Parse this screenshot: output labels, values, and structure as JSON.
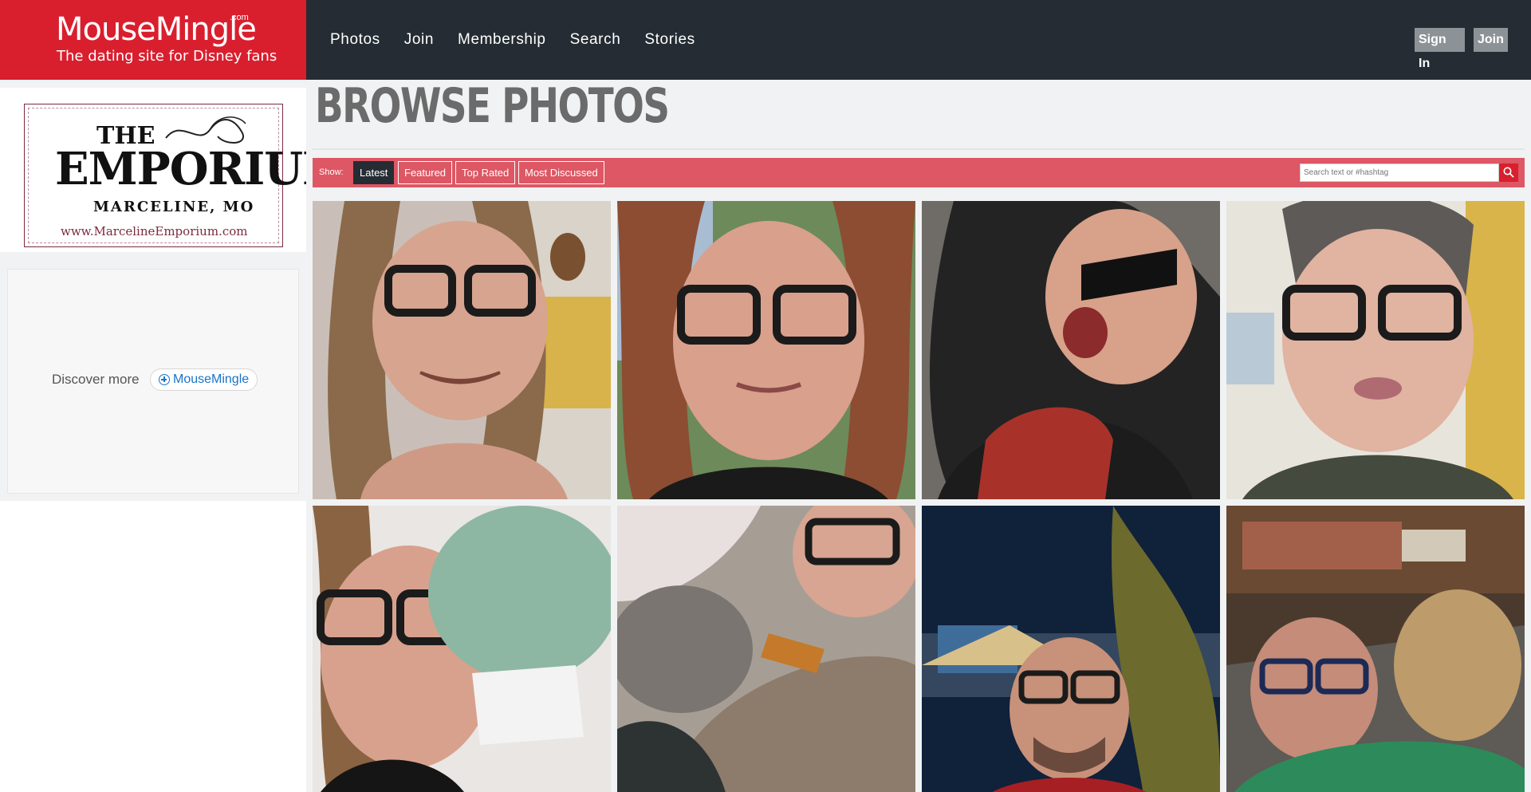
{
  "brand": {
    "name": "MouseMingle",
    "com": ".com",
    "tagline": "The dating site for Disney fans"
  },
  "nav": {
    "items": [
      "Photos",
      "Join",
      "Membership",
      "Search",
      "Stories"
    ]
  },
  "auth": {
    "sign_in": "Sign In",
    "join": "Join"
  },
  "sidebar": {
    "ad": {
      "line1": "THE",
      "line2": "EMPORIUM",
      "location": "MARCELINE, MO",
      "url": "www.MarcelineEmporium.com"
    },
    "discover": {
      "label": "Discover more",
      "link": "MouseMingle"
    }
  },
  "main": {
    "title": "BROWSE PHOTOS",
    "filter": {
      "show_label": "Show:",
      "buttons": [
        "Latest",
        "Featured",
        "Top Rated",
        "Most Discussed"
      ],
      "active": "Latest",
      "search_placeholder": "Search text or #hashtag"
    }
  },
  "colors": {
    "brand_red": "#d91f2e",
    "header_dark": "#252c33",
    "filter_red": "#dd5764",
    "link_blue": "#1a73c8"
  },
  "icons": [
    "search-icon",
    "plus-circle-icon"
  ]
}
